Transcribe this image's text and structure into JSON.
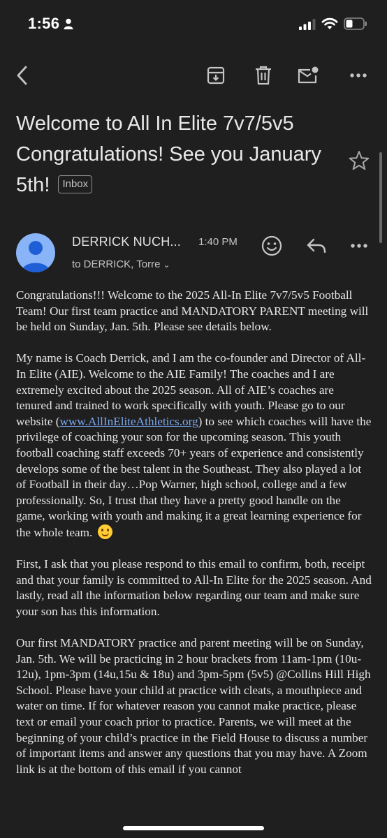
{
  "status_bar": {
    "time": "1:56",
    "icons": [
      "person-icon",
      "signal-icon",
      "wifi-icon",
      "battery-icon"
    ]
  },
  "toolbar": {
    "icons": [
      "back-arrow-icon",
      "archive-icon",
      "trash-icon",
      "mark-unread-icon",
      "more-vert-icon"
    ]
  },
  "email": {
    "subject": "Welcome to All In Elite 7v7/5v5 Congratulations! See you January 5th!",
    "label": "Inbox",
    "sender": "DERRICK NUCH...",
    "time": "1:40 PM",
    "recipients": "to DERRICK, Torre",
    "body": {
      "p1": "Congratulations!!! Welcome to the 2025 All-In Elite 7v7/5v5 Football Team! Our first team practice and MANDATORY PARENT meeting will be held on Sunday, Jan. 5th. Please see details below.",
      "p2_before_link": "My name is Coach Derrick, and I am the co-founder and Director of All-In Elite (AIE). Welcome to the AIE Family! The coaches and I are extremely excited about the 2025 season. All of AIE’s coaches are tenured and trained to work specifically with youth. Please go to our website (",
      "p2_link": "www.AllInEliteAthletics.org",
      "p2_after_link": ") to see which coaches will have the privilege of coaching your son for the upcoming season. This youth football coaching staff exceeds 70+ years of experience and consistently develops some of the best talent in the Southeast. They also played a lot of Football in their day…Pop Warner, high school, college and a few professionally. So, I trust that they have a pretty good handle on the game, working with youth and making it a great learning experience for the whole team.",
      "p3": "First, I ask that you please respond to this email to confirm, both, receipt and that your family is committed to All-In Elite for the 2025 season. And lastly, read all the information below regarding our team and make sure your son has this information.",
      "p4": "Our first MANDATORY practice and parent meeting will be on Sunday, Jan. 5th. We will be practicing in 2 hour brackets from 11am-1pm (10u-12u), 1pm-3pm (14u,15u & 18u) and 3pm-5pm (5v5) @Collins Hill High School. Please have your child at practice with cleats, a mouthpiece and water on time.  If for whatever reason you cannot make practice, please text or email your coach prior to practice. Parents, we will meet at the beginning of your child’s practice in the Field House to discuss a number of important items and answer any questions that you may have. A Zoom link is at the bottom of this email if you cannot"
    }
  },
  "colors": {
    "background": "#1f1f1f",
    "text": "#e3e3e3",
    "link": "#7aa7f2",
    "avatar": "#8ab4f8"
  }
}
